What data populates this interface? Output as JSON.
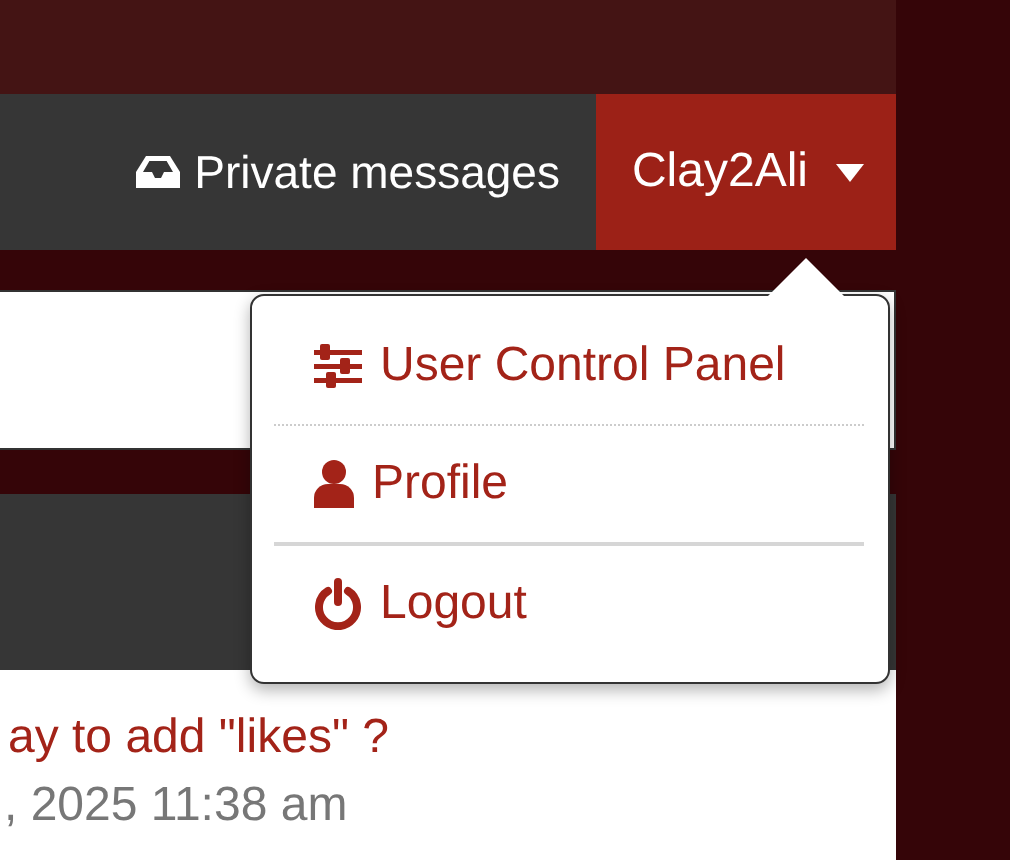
{
  "nav": {
    "items": [
      {
        "kind": "messages",
        "label": "Private messages"
      }
    ],
    "user": {
      "name": "Clay2Ali",
      "expanded": true
    }
  },
  "user_menu": {
    "items": [
      {
        "kind": "control-panel",
        "label": "User Control Panel"
      },
      {
        "kind": "dotted"
      },
      {
        "kind": "profile",
        "label": "Profile"
      },
      {
        "kind": "rule"
      },
      {
        "kind": "logout",
        "label": "Logout"
      }
    ]
  },
  "topic": {
    "title": "ay to add \"likes\" ?",
    "date": ", 2025 11:38 am"
  }
}
